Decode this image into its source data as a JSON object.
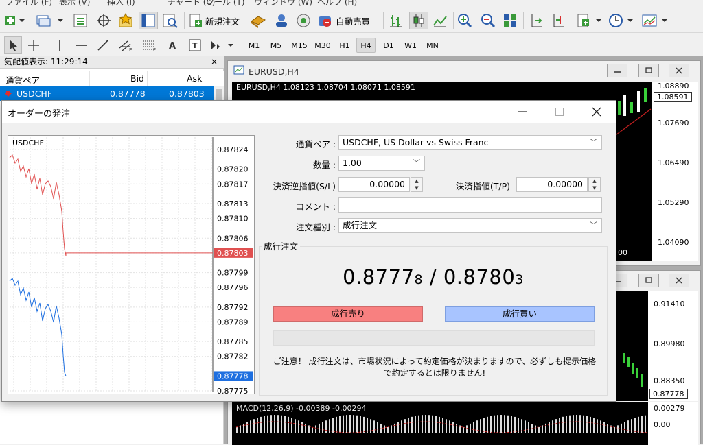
{
  "menu": [
    "ファイル (F)",
    "表示 (V)",
    "挿入 (I)",
    "チャート (C)",
    "ツール (T)",
    "ウィンドウ (W)",
    "ヘルプ (H)"
  ],
  "toolbar": {
    "new_order_label": "新規注文",
    "auto_trade_label": "自動売買",
    "timeframes": [
      "M1",
      "M5",
      "M15",
      "M30",
      "H1",
      "H4",
      "D1",
      "W1",
      "MN"
    ],
    "active_timeframe": "H4"
  },
  "market_watch": {
    "title": "気配値表示: 11:29:14",
    "close": "×",
    "col_symbol": "通貨ペア",
    "col_bid": "Bid",
    "col_ask": "Ask",
    "rows": [
      {
        "symbol": "USDCHF",
        "bid": "0.87778",
        "ask": "0.87803"
      }
    ]
  },
  "chart_window_1": {
    "title": "EURUSD,H4",
    "info": "EURUSD,H4  1.08123 1.08704 1.08071 1.08591",
    "prices": [
      "1.08890",
      "1.08591",
      "1.07690",
      "1.06490",
      "1.05290",
      "1.04090"
    ],
    "time_fragment": "00"
  },
  "chart_window_2": {
    "prices": [
      "0.91410",
      "0.89980",
      "0.88350",
      "0.87778"
    ],
    "macd_label": "MACD(12,26,9) -0.00389 -0.00294",
    "macd_prices": [
      "0.00279",
      "0.00"
    ]
  },
  "dialog": {
    "title": "オーダーの発注",
    "symbol_label": "通貨ペア :",
    "symbol_value": "USDCHF, US Dollar vs Swiss Franc",
    "volume_label": "数量 :",
    "volume_value": "1.00",
    "sl_label": "決済逆指値(S/L)",
    "sl_value": "0.00000",
    "tp_label": "決済指値(T/P)",
    "tp_value": "0.00000",
    "comment_label": "コメント :",
    "comment_value": "",
    "type_label": "注文種別 :",
    "type_value": "成行注文",
    "group_label": "成行注文",
    "bid_main": "0.8777",
    "bid_small": "8",
    "sep": " / ",
    "ask_main": "0.8780",
    "ask_small": "3",
    "sell_label": "成行売り",
    "buy_label": "成行買い",
    "note": "ご注意！ 成行注文は、市場状況によって約定価格が決まりますので、必ずしも提示価格で約定するとは限りません!"
  },
  "mini_chart": {
    "symbol": "USDCHF",
    "price_labels": [
      "0.87824",
      "0.87820",
      "0.87817",
      "0.87813",
      "0.87810",
      "0.87806",
      "0.87803",
      "0.87799",
      "0.87796",
      "0.87792",
      "0.87789",
      "0.87785",
      "0.87782",
      "0.87778",
      "0.87775"
    ],
    "ask_marker": "0.87803",
    "bid_marker": "0.87778"
  },
  "colors": {
    "selection": "#0078d7",
    "sell": "#f88080",
    "buy": "#a8c4ff",
    "ask_line": "#e05050",
    "bid_line": "#1e6fe0"
  }
}
